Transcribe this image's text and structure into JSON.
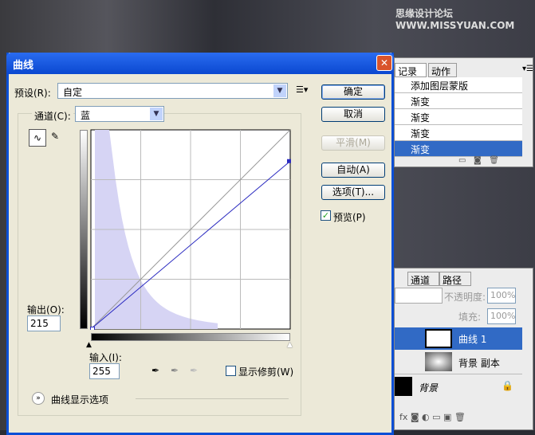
{
  "watermark": "思缘设计论坛 WWW.MISSYUAN.COM",
  "dialog": {
    "title": "曲线",
    "close": "✕",
    "preset_label": "预设(R):",
    "preset_value": "自定",
    "channel_label": "通道(C):",
    "channel_value": "蓝",
    "output_label": "输出(O):",
    "output_value": "215",
    "input_label": "输入(I):",
    "input_value": "255",
    "show_clipping": "显示修剪(W)",
    "show_clipping_checked": false,
    "curve_options": "曲线显示选项",
    "buttons": {
      "ok": "确定",
      "cancel": "取消",
      "smooth": "平滑(M)",
      "auto": "自动(A)",
      "options": "选项(T)..."
    },
    "preview_label": "预览(P)",
    "preview_checked": true,
    "curve_points": [
      [
        0,
        0
      ],
      [
        255,
        215
      ]
    ],
    "histogram_color": "#d6d4f4",
    "curve_color": "#2b2bc0"
  },
  "history_panel": {
    "tabs": [
      "记录",
      "动作"
    ],
    "items": [
      "添加图层蒙版",
      "渐变",
      "渐变",
      "渐变",
      "渐变"
    ],
    "selected": 4
  },
  "layers_panel": {
    "tabs": [
      "通道",
      "路径"
    ],
    "opacity_label": "不透明度:",
    "opacity": "100%",
    "fill_label": "填充:",
    "fill": "100%",
    "layers": [
      {
        "name": "曲线 1",
        "selected": true
      },
      {
        "name": "背景 副本"
      },
      {
        "name": "背景",
        "locked": true
      }
    ]
  }
}
